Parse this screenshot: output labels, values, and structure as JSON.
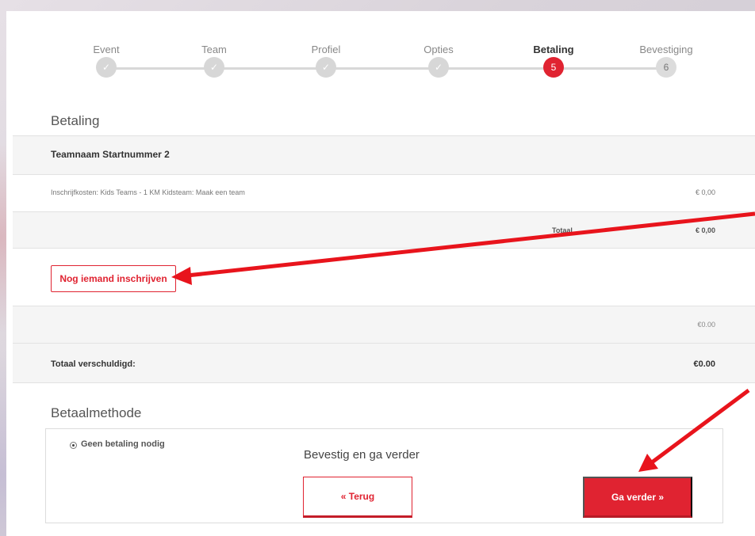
{
  "steps": [
    {
      "label": "Event",
      "marker": "✓",
      "state": "done"
    },
    {
      "label": "Team",
      "marker": "✓",
      "state": "done"
    },
    {
      "label": "Profiel",
      "marker": "✓",
      "state": "done"
    },
    {
      "label": "Opties",
      "marker": "✓",
      "state": "done"
    },
    {
      "label": "Betaling",
      "marker": "5",
      "state": "active"
    },
    {
      "label": "Bevestiging",
      "marker": "6",
      "state": "todo"
    }
  ],
  "payment": {
    "title": "Betaling",
    "team_name": "Teamnaam Startnummer 2",
    "line_item": "Inschrijfkosten: Kids Teams - 1 KM Kidsteam: Maak een team",
    "line_amount": "€ 0,00",
    "total_label": "Totaal",
    "total_amount": "€ 0,00",
    "add_person_button": "Nog iemand inschrijven",
    "subtotal_amount": "€0.00",
    "due_label": "Totaal verschuldigd:",
    "due_amount": "€0.00"
  },
  "method": {
    "title": "Betaalmethode",
    "option_label": "Geen betaling nodig",
    "confirm_text": "Bevestig en ga verder",
    "back_button": "« Terug",
    "next_button": "Ga verder »"
  },
  "colors": {
    "accent": "#e02331",
    "annotation_arrow": "#e8141c"
  }
}
